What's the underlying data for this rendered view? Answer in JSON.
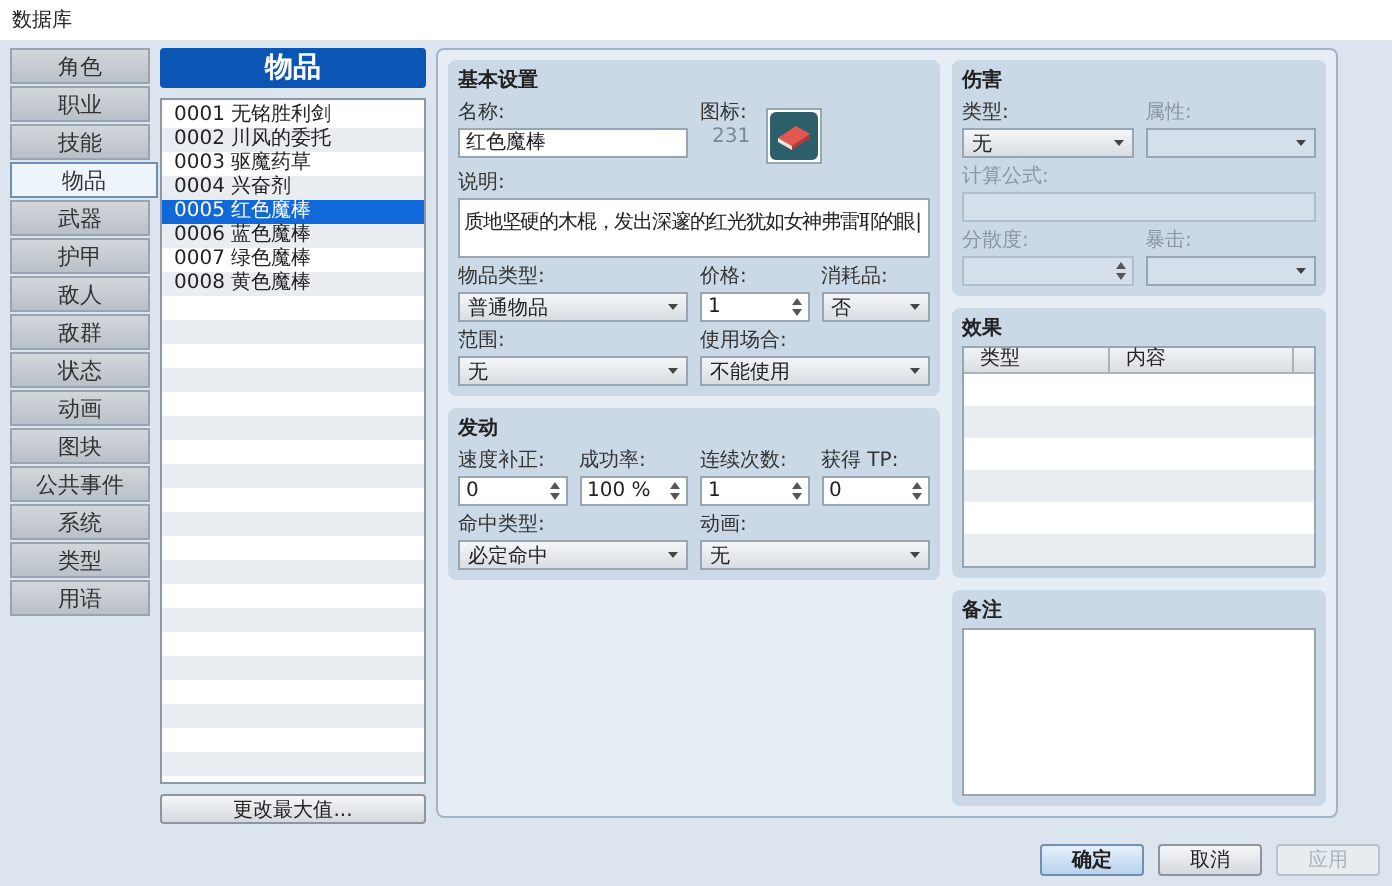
{
  "window": {
    "title": "数据库"
  },
  "nav": {
    "items": [
      {
        "label": "角色",
        "selected": false
      },
      {
        "label": "职业",
        "selected": false
      },
      {
        "label": "技能",
        "selected": false
      },
      {
        "label": "物品",
        "selected": true
      },
      {
        "label": "武器",
        "selected": false
      },
      {
        "label": "护甲",
        "selected": false
      },
      {
        "label": "敌人",
        "selected": false
      },
      {
        "label": "敌群",
        "selected": false
      },
      {
        "label": "状态",
        "selected": false
      },
      {
        "label": "动画",
        "selected": false
      },
      {
        "label": "图块",
        "selected": false
      },
      {
        "label": "公共事件",
        "selected": false
      },
      {
        "label": "系统",
        "selected": false
      },
      {
        "label": "类型",
        "selected": false
      },
      {
        "label": "用语",
        "selected": false
      }
    ]
  },
  "item_list": {
    "title": "物品",
    "items": [
      {
        "label": "0001 无铭胜利剑",
        "selected": false
      },
      {
        "label": "0002 川风的委托",
        "selected": false
      },
      {
        "label": "0003 驱魔药草",
        "selected": false
      },
      {
        "label": "0004 兴奋剂",
        "selected": false
      },
      {
        "label": "0005 红色魔棒",
        "selected": true
      },
      {
        "label": "0006 蓝色魔棒",
        "selected": false
      },
      {
        "label": "0007 绿色魔棒",
        "selected": false
      },
      {
        "label": "0008 黄色魔棒",
        "selected": false
      }
    ],
    "button": "更改最大值..."
  },
  "basic": {
    "title": "基本设置",
    "rows": [
      [
        {
          "kind": "text",
          "label": "名称:",
          "value": "红色魔棒"
        },
        {
          "kind": "icon",
          "label": "图标:",
          "value": "231"
        }
      ],
      [
        {
          "kind": "textarea",
          "label": "说明:",
          "value": "质地坚硬的木棍，发出深邃的红光犹如女神弗雷耶的眼|"
        }
      ],
      [
        {
          "kind": "select",
          "label": "物品类型:",
          "value": "普通物品"
        },
        {
          "kind": "spinner",
          "label": "价格:",
          "value": "1"
        },
        {
          "kind": "select",
          "label": "消耗品:",
          "value": "否"
        }
      ],
      [
        {
          "kind": "select",
          "label": "范围:",
          "value": "无"
        },
        {
          "kind": "select",
          "label": "使用场合:",
          "value": "不能使用"
        }
      ]
    ]
  },
  "invocation": {
    "title": "发动",
    "fields": [
      {
        "kind": "spinner",
        "label": "速度补正:",
        "value": "0"
      },
      {
        "kind": "spinner",
        "label": "成功率:",
        "value": "100 %"
      },
      {
        "kind": "spinner",
        "label": "连续次数:",
        "value": "1"
      },
      {
        "kind": "spinner",
        "label": "获得 TP:",
        "value": "0"
      },
      {
        "kind": "select",
        "label": "命中类型:",
        "value": "必定命中"
      },
      {
        "kind": "select",
        "label": "动画:",
        "value": "无"
      }
    ]
  },
  "damage": {
    "title": "伤害",
    "rows": [
      [
        {
          "kind": "select",
          "label": "类型:",
          "value": "无",
          "disabled": false
        },
        {
          "kind": "select",
          "label": "属性:",
          "disabled": true
        }
      ],
      [
        {
          "kind": "text",
          "label": "计算公式:",
          "disabled": true
        }
      ],
      [
        {
          "kind": "spinner",
          "label": "分散度:",
          "disabled": true
        },
        {
          "kind": "select",
          "label": "暴击:",
          "disabled": true
        }
      ]
    ]
  },
  "effects": {
    "title": "效果",
    "columns": [
      "类型",
      "内容"
    ]
  },
  "note": {
    "title": "备注"
  },
  "buttons": [
    {
      "label": "确定",
      "default": true,
      "disabled": false
    },
    {
      "label": "取消",
      "default": false,
      "disabled": false
    },
    {
      "label": "应用",
      "default": false,
      "disabled": true
    }
  ]
}
